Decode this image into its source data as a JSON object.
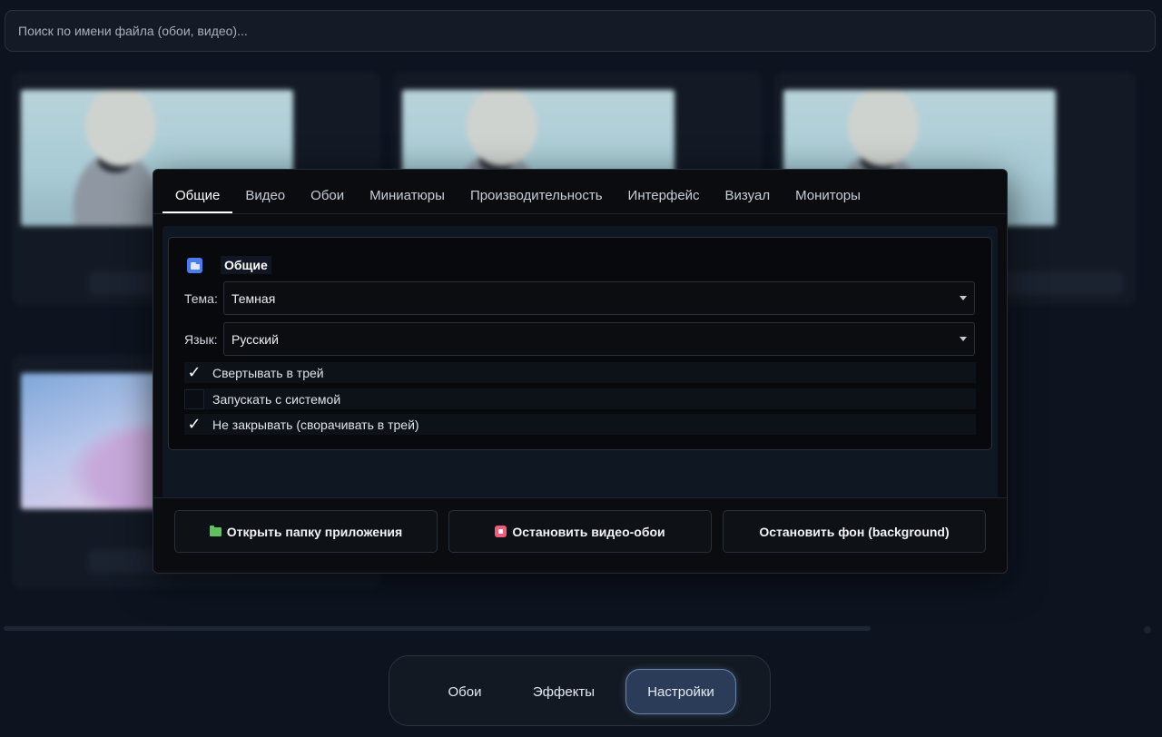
{
  "search": {
    "placeholder": "Поиск по имени файла (обои, видео)..."
  },
  "dialog": {
    "tabs": [
      {
        "label": "Общие",
        "active": true
      },
      {
        "label": "Видео"
      },
      {
        "label": "Обои"
      },
      {
        "label": "Миниатюры"
      },
      {
        "label": "Производительность"
      },
      {
        "label": "Интерфейс"
      },
      {
        "label": "Визуал"
      },
      {
        "label": "Мониторы"
      }
    ],
    "group": {
      "title": "Общие",
      "icon": "folder-icon",
      "theme_label": "Тема:",
      "theme_value": "Темная",
      "language_label": "Язык:",
      "language_value": "Русский",
      "checkboxes": [
        {
          "label": "Свертывать в трей",
          "checked": true
        },
        {
          "label": "Запускать с системой",
          "checked": false
        },
        {
          "label": "Не закрывать (сворачивать в трей)",
          "checked": true
        }
      ]
    },
    "buttons": {
      "open_folder": "Открыть папку приложения",
      "stop_video": "Остановить видео-обои",
      "stop_background": "Остановить фон (background)"
    }
  },
  "nav": {
    "items": [
      {
        "label": "Обои"
      },
      {
        "label": "Эффекты"
      },
      {
        "label": "Настройки",
        "active": true
      }
    ]
  },
  "colors": {
    "accent_blue": "#4a7cf0",
    "folder_green": "#5ec25e",
    "stop_pink": "#f25b7a",
    "nav_active": "#2a3c58"
  }
}
